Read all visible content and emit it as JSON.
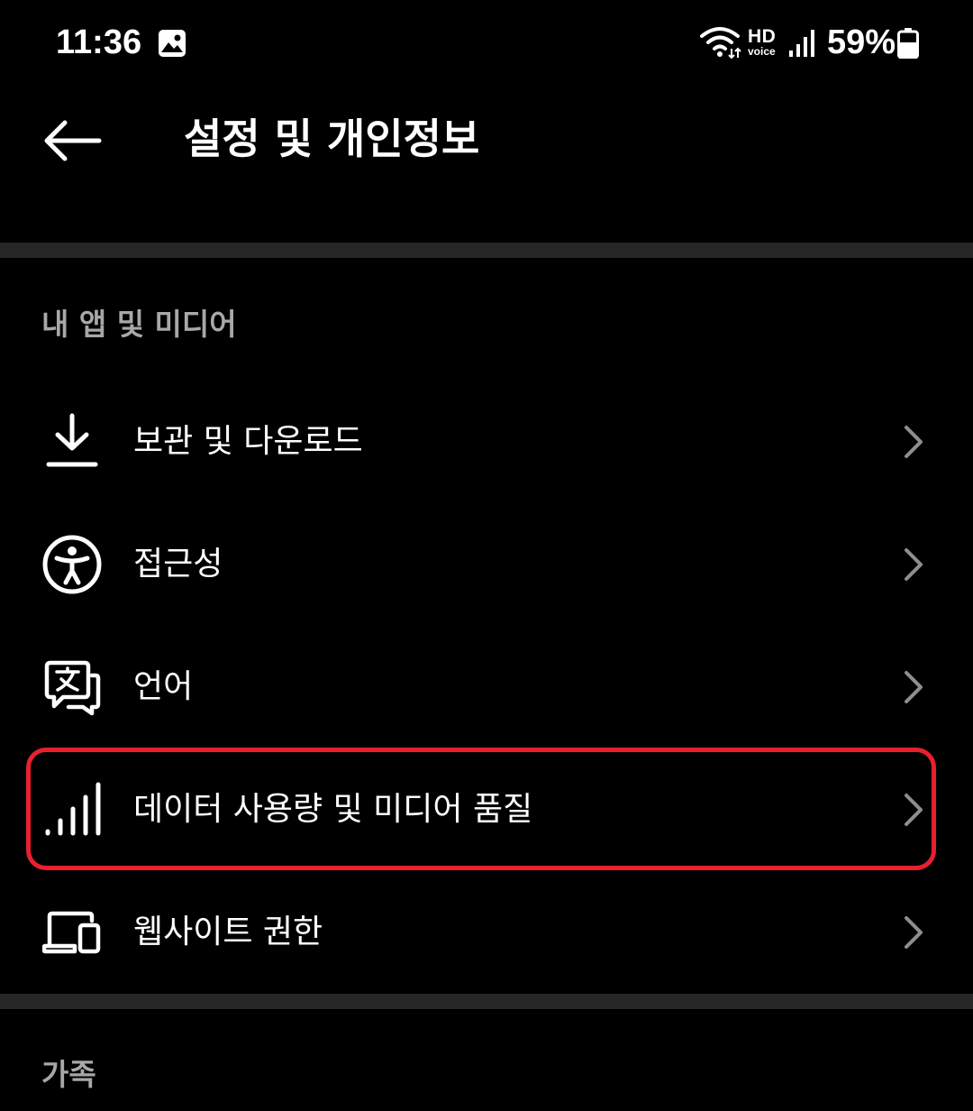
{
  "status_bar": {
    "time": "11:36",
    "hd_label": "HD",
    "voice_label": "voice",
    "battery": "59%"
  },
  "header": {
    "title": "설정 및 개인정보"
  },
  "sections": [
    {
      "header": "내 앱 및 미디어",
      "items": [
        {
          "label": "보관 및 다운로드",
          "icon": "download-icon"
        },
        {
          "label": "접근성",
          "icon": "accessibility-icon"
        },
        {
          "label": "언어",
          "icon": "language-icon"
        },
        {
          "label": "데이터 사용량 및 미디어 품질",
          "icon": "signal-bars-icon",
          "highlighted": true
        },
        {
          "label": "웹사이트 권한",
          "icon": "devices-icon"
        }
      ]
    },
    {
      "header": "가족"
    }
  ],
  "colors": {
    "background": "#000000",
    "divider": "#262626",
    "section_header": "#a8a8a8",
    "chevron": "#8e8e8e",
    "highlight": "#e8202e"
  }
}
